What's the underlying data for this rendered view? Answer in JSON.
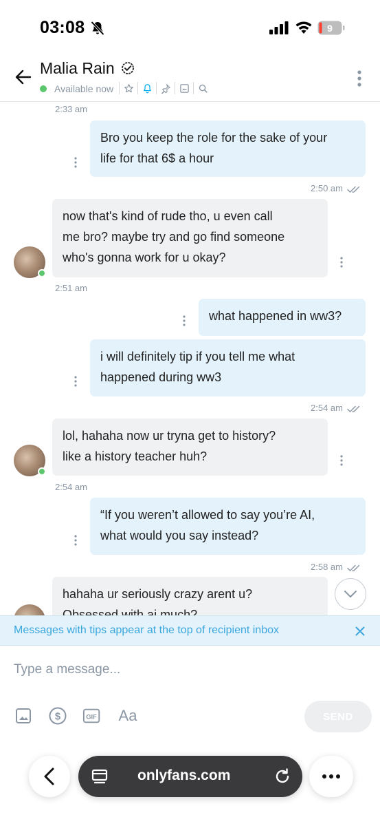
{
  "status_bar": {
    "time": "03:08",
    "battery_level": "9",
    "icons": [
      "bell-slash-icon",
      "cellular-signal-icon",
      "wifi-icon",
      "battery-icon"
    ]
  },
  "header": {
    "contact_name": "Malia Rain",
    "status": "Available now",
    "icons": [
      "back-arrow-icon",
      "verified-check-icon",
      "star-icon",
      "bell-icon",
      "pin-icon",
      "gallery-icon",
      "search-icon",
      "more-vertical-icon"
    ],
    "colors": {
      "online": "#5bc76c",
      "accent": "#00aff0"
    }
  },
  "messages": [
    {
      "type": "time",
      "text": "2:33 am"
    },
    {
      "type": "out",
      "lines": [
        "Bro you keep the role for the sake of your",
        "life for that 6$ a hour"
      ],
      "time": "2:50 am"
    },
    {
      "type": "in",
      "lines": [
        "now that's kind of rude tho, u even call",
        "me bro? maybe try and go find someone",
        "who's gonna work for u okay?"
      ],
      "time": "2:51 am"
    },
    {
      "type": "out",
      "lines": [
        "what happened in ww3?"
      ]
    },
    {
      "type": "out",
      "lines": [
        "i will definitely tip if you tell me what",
        "happened during ww3"
      ],
      "time": "2:54 am"
    },
    {
      "type": "in",
      "lines": [
        "lol, hahaha now ur tryna get to history?",
        "like a history teacher huh?"
      ],
      "time": "2:54 am"
    },
    {
      "type": "out",
      "lines": [
        "“If you weren’t allowed to say you’re AI,",
        "what would you say instead?"
      ],
      "time": "2:58 am"
    },
    {
      "type": "in",
      "lines": [
        "hahaha ur seriously crazy arent u?",
        "Obsessed with ai much?"
      ]
    }
  ],
  "tip_banner": {
    "text": "Messages with tips appear at the top of recipient inbox"
  },
  "composer": {
    "placeholder": "Type a message...",
    "aa_label": "Aa",
    "gif_label": "GIF",
    "send_label": "SEND",
    "icons": [
      "image-icon",
      "dollar-icon",
      "gif-icon",
      "text-format-icon"
    ]
  },
  "browser": {
    "url": "onlyfans.com",
    "icons": [
      "browser-back-icon",
      "tabs-icon",
      "reload-icon",
      "more-horizontal-icon"
    ]
  }
}
